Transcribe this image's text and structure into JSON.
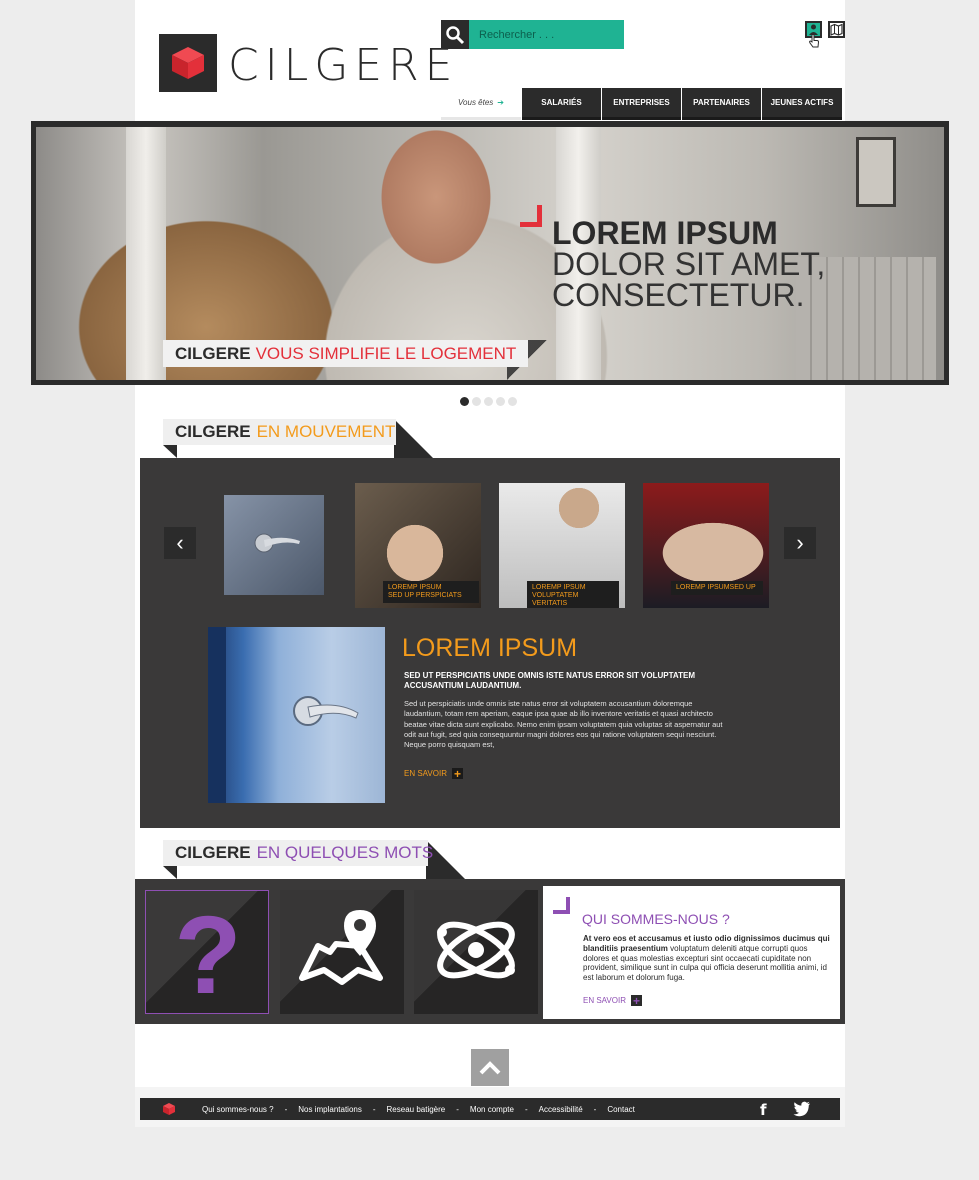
{
  "brand": {
    "name": "CILGERE"
  },
  "search": {
    "placeholder": "Rechercher . . ."
  },
  "nav": {
    "you_label": "Vous êtes",
    "items": [
      "SALARIÉS",
      "ENTREPRISES",
      "PARTENAIRES",
      "JEUNES ACTIFS"
    ]
  },
  "hero": {
    "line1": "LOREM IPSUM",
    "line2": "DOLOR SIT AMET,",
    "line3": "CONSECTETUR.",
    "tag_brand": "CILGERE",
    "tag_text": "VOUS SIMPLIFIE LE LOGEMENT",
    "slides": 5,
    "active_slide": 1
  },
  "mouvement": {
    "heading_brand": "CILGERE",
    "heading_text": "EN MOUVEMENT",
    "thumbs": [
      {
        "caption": ""
      },
      {
        "caption1": "LOREMP IPSUM",
        "caption2": "SED UP PERSPICIATS"
      },
      {
        "caption1": "LOREMP IPSUM",
        "caption2": "VOLUPTATEM VERITATIS"
      },
      {
        "caption1": "LOREMP IPSUMSED UP",
        "caption2": ""
      }
    ],
    "feature": {
      "title": "LOREM IPSUM",
      "subtitle": "SED UT PERSPICIATIS UNDE OMNIS ISTE NATUS ERROR SIT VOLUPTATEM ACCUSANTIUM LAUDANTIUM.",
      "body": "Sed ut perspiciatis unde omnis iste natus error sit voluptatem accusantium doloremque laudantium, totam rem aperiam, eaque ipsa quae ab illo inventore veritatis et quasi architecto beatae vitae dicta sunt explicabo. Nemo enim ipsam voluptatem quia voluptas sit aspernatur aut odit aut fugit, sed quia consequuntur magni dolores eos qui ratione voluptatem sequi nesciunt. Neque porro quisquam est,",
      "more": "EN SAVOIR"
    }
  },
  "quelques": {
    "heading_brand": "CILGERE",
    "heading_text": "EN QUELQUES MOTS",
    "title": "QUI SOMMES-NOUS ?",
    "body_bold": "At vero eos et accusamus et iusto odio dignissimos ducimus qui blanditiis praesentium",
    "body": " voluptatum deleniti atque corrupti quos dolores et quas molestias excepturi sint occaecati cupiditate non provident, similique sunt in culpa qui officia deserunt mollitia animi, id est laborum et dolorum fuga.",
    "more": "EN SAVOIR"
  },
  "footer": {
    "links": [
      "Qui sommes-nous ?",
      "Nos implantations",
      "Reseau batigère",
      "Mon compte",
      "Accessibilité",
      "Contact"
    ],
    "separator": "-"
  },
  "colors": {
    "accent_red": "#e3303a",
    "accent_green": "#1fb393",
    "accent_orange": "#f39b1c",
    "accent_purple": "#8e4fb3",
    "dark": "#2b2b2b"
  }
}
